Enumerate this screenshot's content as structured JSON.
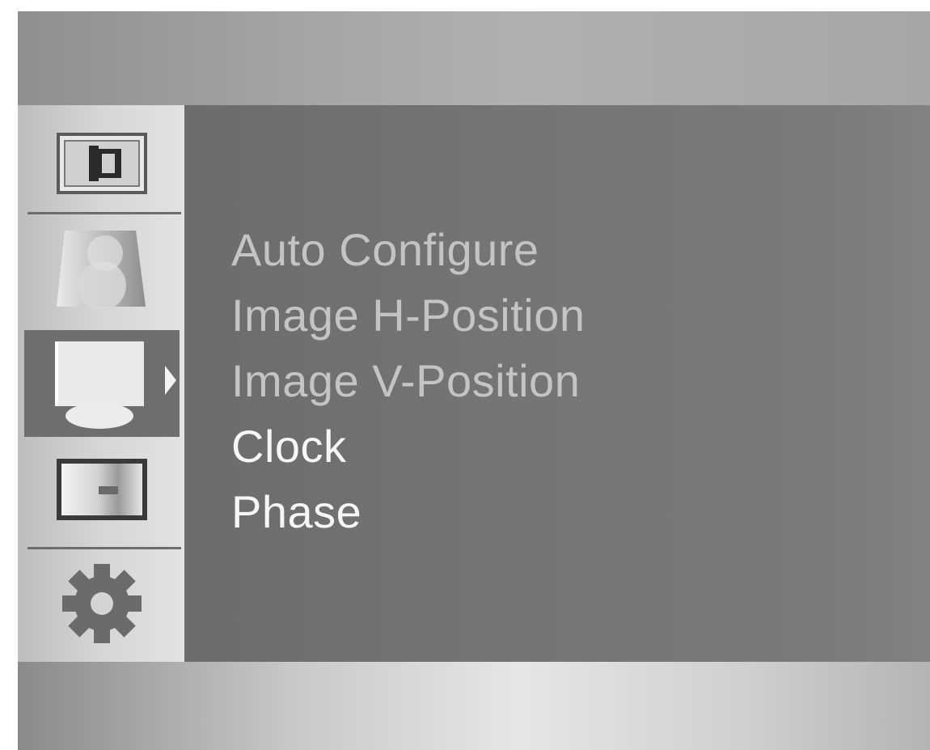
{
  "osd": {
    "menu_items": [
      "Auto Configure",
      "Image H-Position",
      "Image V-Position",
      "Clock",
      "Phase"
    ],
    "sidebar_icons": [
      "picture-icon",
      "color-icon",
      "display-position-icon",
      "image-quality-icon",
      "setup-gear-icon"
    ],
    "selected_category": "display-position-icon",
    "colors": {
      "panel": "#747474",
      "sidebar": "#d6d6d6",
      "selected": "#6e6e6e",
      "text": "#f6f6f6",
      "text_dim": "#c4c4c4"
    }
  }
}
